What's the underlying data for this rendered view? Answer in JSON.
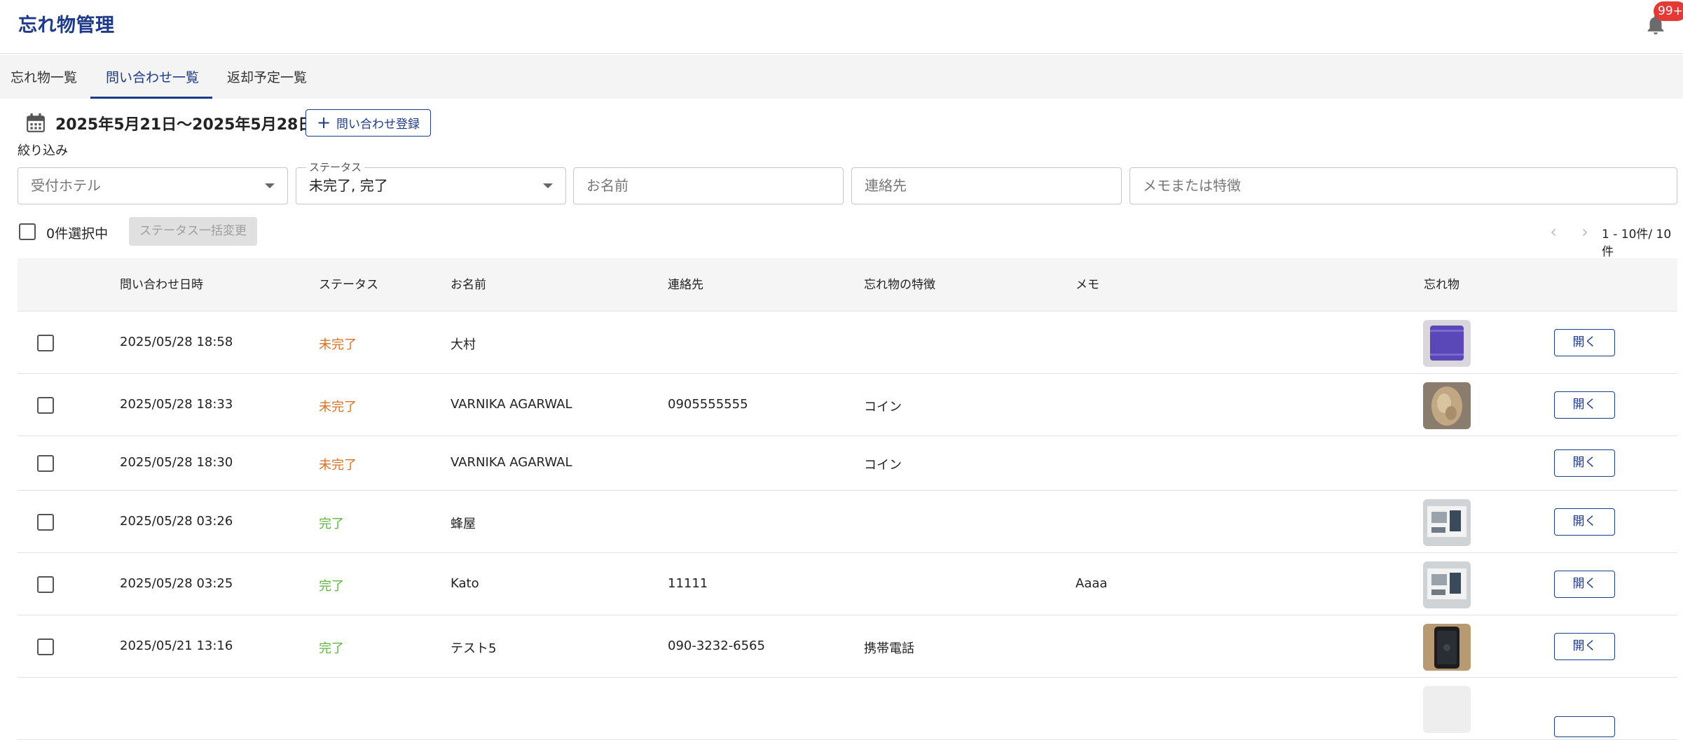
{
  "app": {
    "title": "忘れ物管理",
    "notification_badge": "99+"
  },
  "tabs": [
    {
      "label": "忘れ物一覧",
      "active": false
    },
    {
      "label": "問い合わせ一覧",
      "active": true
    },
    {
      "label": "返却予定一覧",
      "active": false
    }
  ],
  "toolbar": {
    "date_range": "2025年5月21日〜2025年5月28日",
    "add_inquiry_label": "問い合わせ登録",
    "filter_label": "絞り込み"
  },
  "filters": {
    "hotel_placeholder": "受付ホテル",
    "status_label": "ステータス",
    "status_value": "未完了, 完了",
    "name_placeholder": "お名前",
    "contact_placeholder": "連絡先",
    "memo_placeholder": "メモまたは特徴"
  },
  "selection": {
    "count_label": "0件選択中",
    "bulk_status_label": "ステータス一括変更"
  },
  "pagination": {
    "info": "1 - 10件/ 10件"
  },
  "table": {
    "headers": {
      "date": "問い合わせ日時",
      "status": "ステータス",
      "name": "お名前",
      "contact": "連絡先",
      "feature": "忘れ物の特徴",
      "memo": "メモ",
      "item": "忘れ物"
    },
    "open_label": "開く",
    "rows": [
      {
        "date": "2025/05/28 18:58",
        "status": "未完了",
        "status_kind": "pending",
        "name": "大村",
        "contact": "",
        "feature": "",
        "memo": "",
        "thumb": "purple-towel"
      },
      {
        "date": "2025/05/28 18:33",
        "status": "未完了",
        "status_kind": "pending",
        "name": "VARNIKA AGARWAL",
        "contact": "0905555555",
        "feature": "コイン",
        "memo": "",
        "thumb": "gold-fabric"
      },
      {
        "date": "2025/05/28 18:30",
        "status": "未完了",
        "status_kind": "pending",
        "name": "VARNIKA AGARWAL",
        "contact": "",
        "feature": "コイン",
        "memo": "",
        "thumb": ""
      },
      {
        "date": "2025/05/28 03:26",
        "status": "完了",
        "status_kind": "done",
        "name": "蜂屋",
        "contact": "",
        "feature": "",
        "memo": "",
        "thumb": "device-box"
      },
      {
        "date": "2025/05/28 03:25",
        "status": "完了",
        "status_kind": "done",
        "name": "Kato",
        "contact": "11111",
        "feature": "",
        "memo": "Aaaa",
        "thumb": "device-box"
      },
      {
        "date": "2025/05/21 13:16",
        "status": "完了",
        "status_kind": "done",
        "name": "テスト5",
        "contact": "090-3232-6565",
        "feature": "携帯電話",
        "memo": "",
        "thumb": "phone"
      },
      {
        "date": "",
        "status": "",
        "status_kind": "",
        "name": "",
        "contact": "",
        "feature": "",
        "memo": "",
        "thumb": "blank"
      }
    ]
  },
  "colors": {
    "brand": "#1e3a8a",
    "pending": "#e07020",
    "done": "#5fb83e",
    "badge": "#e53935"
  },
  "icons": [
    "bell-icon",
    "calendar-icon",
    "plus-icon",
    "chevron-left-icon",
    "chevron-right-icon",
    "caret-down-icon"
  ]
}
